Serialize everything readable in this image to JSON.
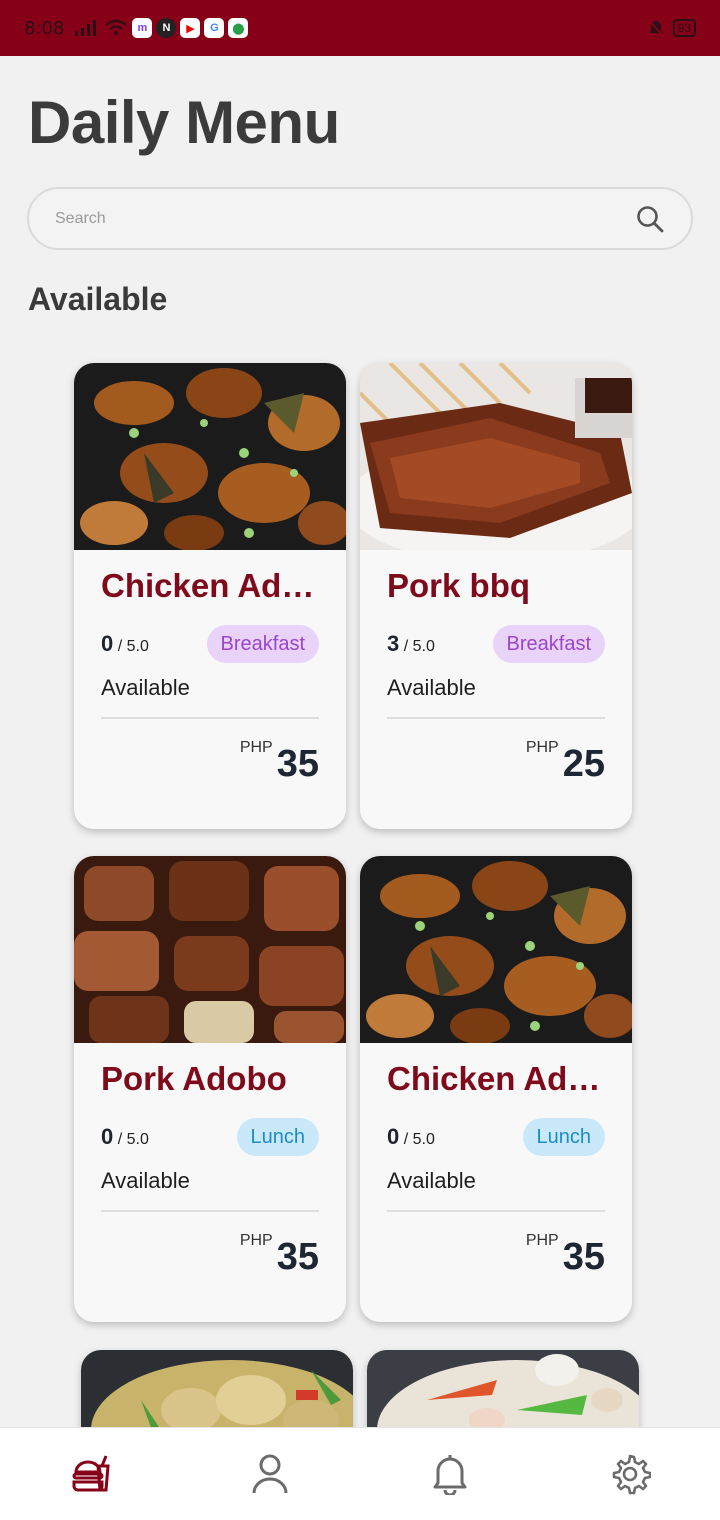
{
  "status_bar": {
    "time": "8:08",
    "battery": "93"
  },
  "page": {
    "title": "Daily Menu",
    "section": "Available"
  },
  "search": {
    "placeholder": "Search"
  },
  "colors": {
    "brand": "#860018",
    "title_red": "#7e0a1c",
    "breakfast_bg": "#ead3f8",
    "lunch_bg": "#c9e9fb"
  },
  "menu_items": [
    {
      "name": "Chicken Ado…",
      "rating": "0",
      "max_rating": "/ 5.0",
      "category": "Breakfast",
      "status": "Available",
      "currency": "PHP",
      "price": "35",
      "image": "chicken-adobo-image"
    },
    {
      "name": "Pork bbq",
      "rating": "3",
      "max_rating": "/ 5.0",
      "category": "Breakfast",
      "status": "Available",
      "currency": "PHP",
      "price": "25",
      "image": "pork-bbq-image"
    },
    {
      "name": "Pork Adobo",
      "rating": "0",
      "max_rating": "/ 5.0",
      "category": "Lunch",
      "status": "Available",
      "currency": "PHP",
      "price": "35",
      "image": "pork-adobo-image"
    },
    {
      "name": "Chicken Ado…",
      "rating": "0",
      "max_rating": "/ 5.0",
      "category": "Lunch",
      "status": "Available",
      "currency": "PHP",
      "price": "35",
      "image": "chicken-adobo-image"
    }
  ],
  "bottom_nav": [
    {
      "icon": "food-icon",
      "active": true
    },
    {
      "icon": "profile-icon",
      "active": false
    },
    {
      "icon": "bell-icon",
      "active": false
    },
    {
      "icon": "gear-icon",
      "active": false
    }
  ]
}
